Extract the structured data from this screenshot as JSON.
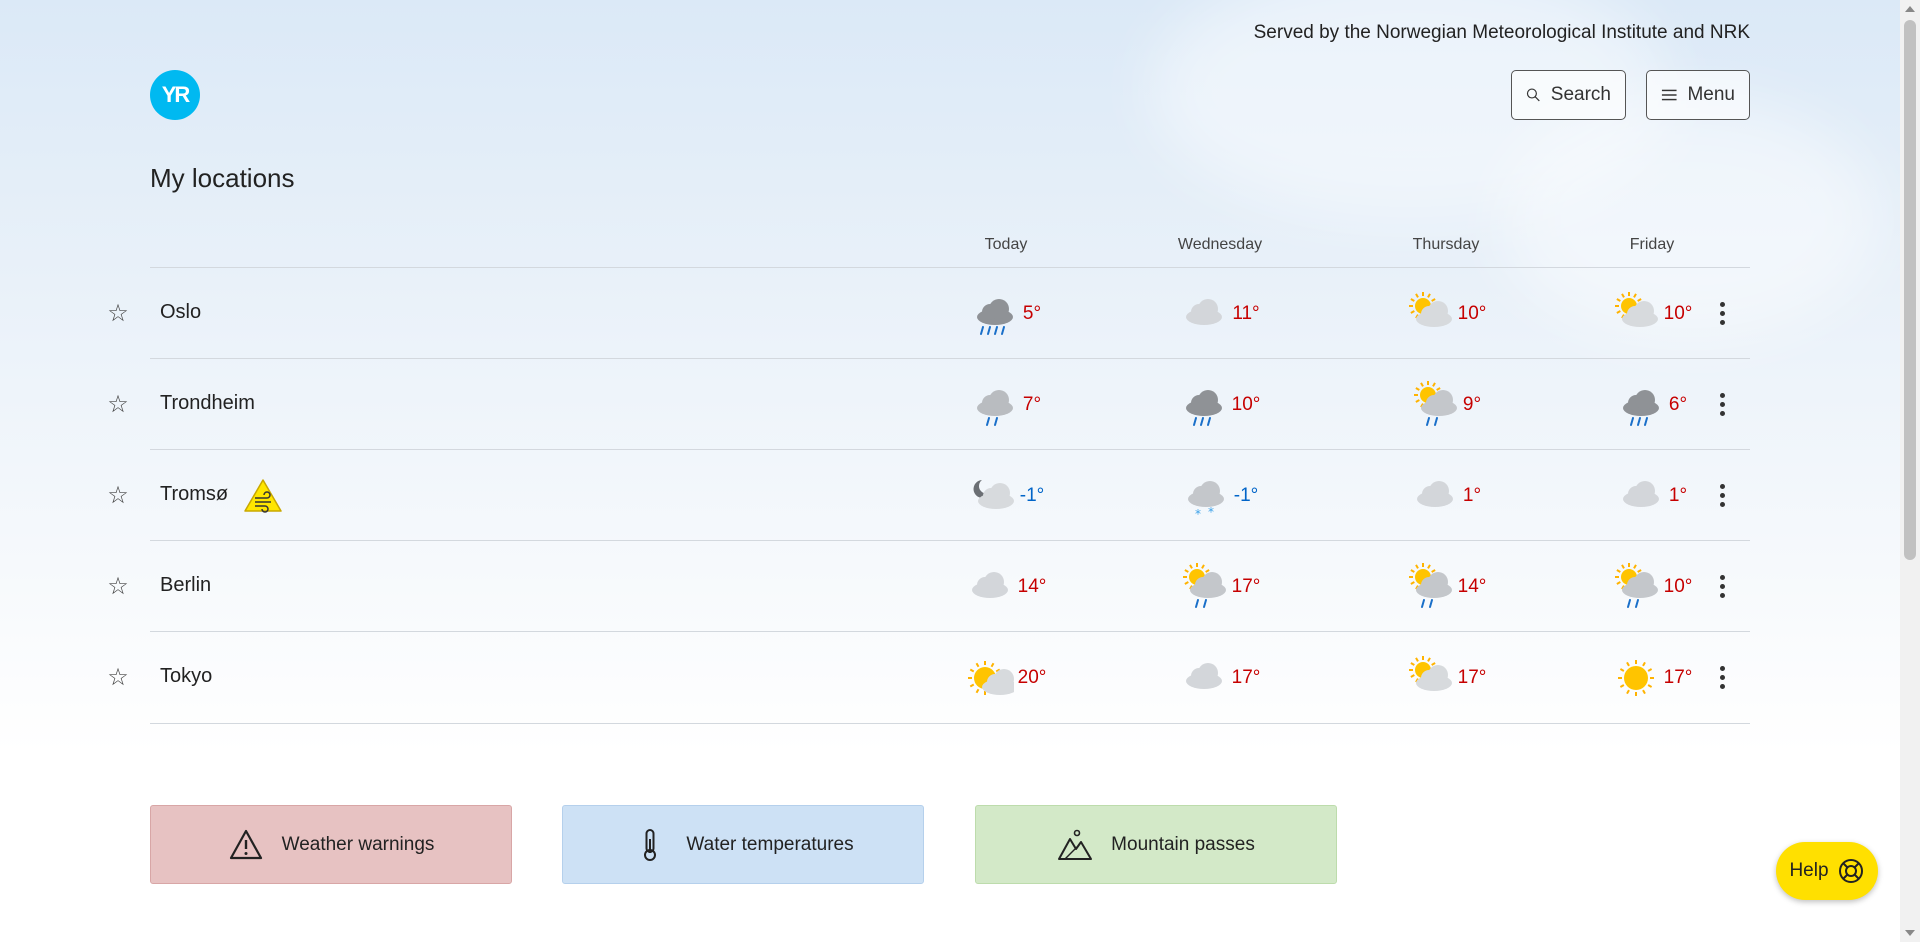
{
  "header": {
    "served_by": "Served by the Norwegian Meteorological Institute and NRK",
    "logo_text": "YR",
    "search_label": "Search",
    "menu_label": "Menu"
  },
  "page_title": "My locations",
  "days": [
    "Today",
    "Wednesday",
    "Thursday",
    "Friday"
  ],
  "locations": [
    {
      "name": "Oslo",
      "warning": false,
      "forecast": [
        {
          "icon": "heavy-rain",
          "temp": "5°",
          "tone": "warm"
        },
        {
          "icon": "cloudy",
          "temp": "11°",
          "tone": "warm"
        },
        {
          "icon": "partly-cloudy-day",
          "temp": "10°",
          "tone": "warm"
        },
        {
          "icon": "partly-cloudy-day",
          "temp": "10°",
          "tone": "warm"
        }
      ]
    },
    {
      "name": "Trondheim",
      "warning": false,
      "forecast": [
        {
          "icon": "light-rain",
          "temp": "7°",
          "tone": "warm"
        },
        {
          "icon": "rain",
          "temp": "10°",
          "tone": "warm"
        },
        {
          "icon": "sun-showers",
          "temp": "9°",
          "tone": "warm"
        },
        {
          "icon": "rain",
          "temp": "6°",
          "tone": "warm"
        }
      ]
    },
    {
      "name": "Tromsø",
      "warning": true,
      "warning_icon": "wind-warning-icon",
      "forecast": [
        {
          "icon": "partly-cloudy-night",
          "temp": "-1°",
          "tone": "cold"
        },
        {
          "icon": "light-snow",
          "temp": "-1°",
          "tone": "cold"
        },
        {
          "icon": "cloudy",
          "temp": "1°",
          "tone": "warm"
        },
        {
          "icon": "cloudy",
          "temp": "1°",
          "tone": "warm"
        }
      ]
    },
    {
      "name": "Berlin",
      "warning": false,
      "forecast": [
        {
          "icon": "cloudy",
          "temp": "14°",
          "tone": "warm"
        },
        {
          "icon": "sun-showers",
          "temp": "17°",
          "tone": "warm"
        },
        {
          "icon": "sun-showers",
          "temp": "14°",
          "tone": "warm"
        },
        {
          "icon": "sun-showers",
          "temp": "10°",
          "tone": "warm"
        }
      ]
    },
    {
      "name": "Tokyo",
      "warning": false,
      "forecast": [
        {
          "icon": "fair-day",
          "temp": "20°",
          "tone": "warm"
        },
        {
          "icon": "cloudy",
          "temp": "17°",
          "tone": "warm"
        },
        {
          "icon": "partly-cloudy-day",
          "temp": "17°",
          "tone": "warm"
        },
        {
          "icon": "clear-sun",
          "temp": "17°",
          "tone": "warm"
        }
      ]
    }
  ],
  "tiles": {
    "warnings": "Weather warnings",
    "water": "Water temperatures",
    "mountain": "Mountain passes"
  },
  "help_label": "Help",
  "colors": {
    "logo": "#00b9f1",
    "temp_warm": "#c60000",
    "temp_cold": "#0064c8",
    "help_button": "#ffe000",
    "tile_warnings": "#e7c2c2",
    "tile_water": "#cde1f5",
    "tile_mountain": "#d3e9c8"
  }
}
